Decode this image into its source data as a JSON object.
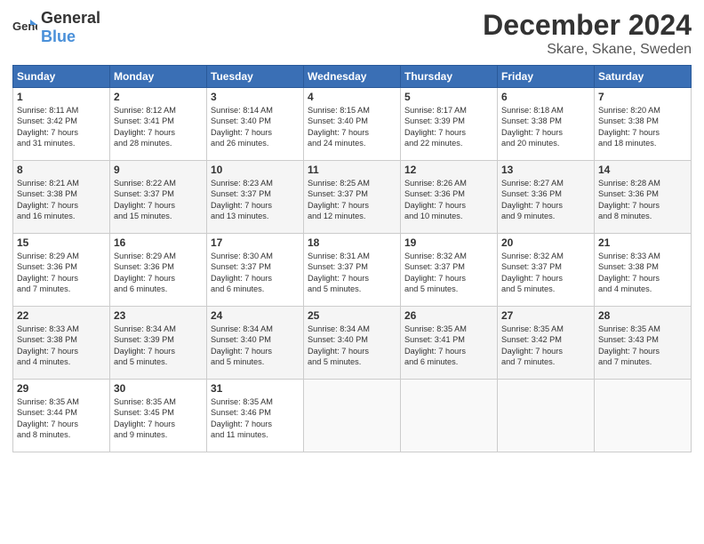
{
  "header": {
    "logo_general": "General",
    "logo_blue": "Blue",
    "title": "December 2024",
    "location": "Skare, Skane, Sweden"
  },
  "columns": [
    "Sunday",
    "Monday",
    "Tuesday",
    "Wednesday",
    "Thursday",
    "Friday",
    "Saturday"
  ],
  "weeks": [
    [
      {
        "day": "1",
        "info": "Sunrise: 8:11 AM\nSunset: 3:42 PM\nDaylight: 7 hours\nand 31 minutes."
      },
      {
        "day": "2",
        "info": "Sunrise: 8:12 AM\nSunset: 3:41 PM\nDaylight: 7 hours\nand 28 minutes."
      },
      {
        "day": "3",
        "info": "Sunrise: 8:14 AM\nSunset: 3:40 PM\nDaylight: 7 hours\nand 26 minutes."
      },
      {
        "day": "4",
        "info": "Sunrise: 8:15 AM\nSunset: 3:40 PM\nDaylight: 7 hours\nand 24 minutes."
      },
      {
        "day": "5",
        "info": "Sunrise: 8:17 AM\nSunset: 3:39 PM\nDaylight: 7 hours\nand 22 minutes."
      },
      {
        "day": "6",
        "info": "Sunrise: 8:18 AM\nSunset: 3:38 PM\nDaylight: 7 hours\nand 20 minutes."
      },
      {
        "day": "7",
        "info": "Sunrise: 8:20 AM\nSunset: 3:38 PM\nDaylight: 7 hours\nand 18 minutes."
      }
    ],
    [
      {
        "day": "8",
        "info": "Sunrise: 8:21 AM\nSunset: 3:38 PM\nDaylight: 7 hours\nand 16 minutes."
      },
      {
        "day": "9",
        "info": "Sunrise: 8:22 AM\nSunset: 3:37 PM\nDaylight: 7 hours\nand 15 minutes."
      },
      {
        "day": "10",
        "info": "Sunrise: 8:23 AM\nSunset: 3:37 PM\nDaylight: 7 hours\nand 13 minutes."
      },
      {
        "day": "11",
        "info": "Sunrise: 8:25 AM\nSunset: 3:37 PM\nDaylight: 7 hours\nand 12 minutes."
      },
      {
        "day": "12",
        "info": "Sunrise: 8:26 AM\nSunset: 3:36 PM\nDaylight: 7 hours\nand 10 minutes."
      },
      {
        "day": "13",
        "info": "Sunrise: 8:27 AM\nSunset: 3:36 PM\nDaylight: 7 hours\nand 9 minutes."
      },
      {
        "day": "14",
        "info": "Sunrise: 8:28 AM\nSunset: 3:36 PM\nDaylight: 7 hours\nand 8 minutes."
      }
    ],
    [
      {
        "day": "15",
        "info": "Sunrise: 8:29 AM\nSunset: 3:36 PM\nDaylight: 7 hours\nand 7 minutes."
      },
      {
        "day": "16",
        "info": "Sunrise: 8:29 AM\nSunset: 3:36 PM\nDaylight: 7 hours\nand 6 minutes."
      },
      {
        "day": "17",
        "info": "Sunrise: 8:30 AM\nSunset: 3:37 PM\nDaylight: 7 hours\nand 6 minutes."
      },
      {
        "day": "18",
        "info": "Sunrise: 8:31 AM\nSunset: 3:37 PM\nDaylight: 7 hours\nand 5 minutes."
      },
      {
        "day": "19",
        "info": "Sunrise: 8:32 AM\nSunset: 3:37 PM\nDaylight: 7 hours\nand 5 minutes."
      },
      {
        "day": "20",
        "info": "Sunrise: 8:32 AM\nSunset: 3:37 PM\nDaylight: 7 hours\nand 5 minutes."
      },
      {
        "day": "21",
        "info": "Sunrise: 8:33 AM\nSunset: 3:38 PM\nDaylight: 7 hours\nand 4 minutes."
      }
    ],
    [
      {
        "day": "22",
        "info": "Sunrise: 8:33 AM\nSunset: 3:38 PM\nDaylight: 7 hours\nand 4 minutes."
      },
      {
        "day": "23",
        "info": "Sunrise: 8:34 AM\nSunset: 3:39 PM\nDaylight: 7 hours\nand 5 minutes."
      },
      {
        "day": "24",
        "info": "Sunrise: 8:34 AM\nSunset: 3:40 PM\nDaylight: 7 hours\nand 5 minutes."
      },
      {
        "day": "25",
        "info": "Sunrise: 8:34 AM\nSunset: 3:40 PM\nDaylight: 7 hours\nand 5 minutes."
      },
      {
        "day": "26",
        "info": "Sunrise: 8:35 AM\nSunset: 3:41 PM\nDaylight: 7 hours\nand 6 minutes."
      },
      {
        "day": "27",
        "info": "Sunrise: 8:35 AM\nSunset: 3:42 PM\nDaylight: 7 hours\nand 7 minutes."
      },
      {
        "day": "28",
        "info": "Sunrise: 8:35 AM\nSunset: 3:43 PM\nDaylight: 7 hours\nand 7 minutes."
      }
    ],
    [
      {
        "day": "29",
        "info": "Sunrise: 8:35 AM\nSunset: 3:44 PM\nDaylight: 7 hours\nand 8 minutes."
      },
      {
        "day": "30",
        "info": "Sunrise: 8:35 AM\nSunset: 3:45 PM\nDaylight: 7 hours\nand 9 minutes."
      },
      {
        "day": "31",
        "info": "Sunrise: 8:35 AM\nSunset: 3:46 PM\nDaylight: 7 hours\nand 11 minutes."
      },
      null,
      null,
      null,
      null
    ]
  ]
}
